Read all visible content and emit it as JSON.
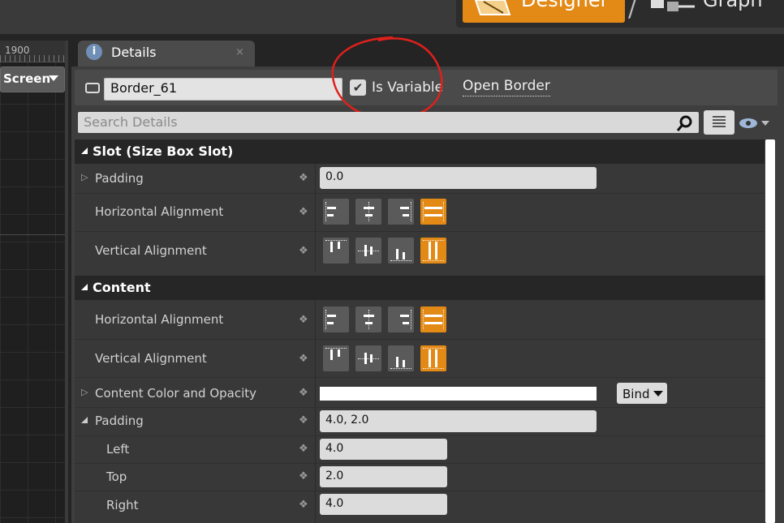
{
  "modes": {
    "designer": "Designer",
    "separator": "/",
    "graph": "Graph"
  },
  "viewport": {
    "ruler_value": "1900",
    "screen_label": "Screen"
  },
  "details": {
    "tab_label": "Details",
    "tab_icon": "i",
    "tab_close": "×",
    "widget_name": "Border_61",
    "is_variable_label": "Is Variable",
    "is_variable_checked": true,
    "checkmark": "✔",
    "open_border_label": "Open Border",
    "search_placeholder": "Search Details"
  },
  "slot": {
    "title": "Slot (Size Box Slot)",
    "padding_label": "Padding",
    "padding_value": "0.0",
    "h_align_label": "Horizontal Alignment",
    "v_align_label": "Vertical Alignment",
    "h_align_selected": "fill",
    "v_align_selected": "fill"
  },
  "content": {
    "title": "Content",
    "h_align_label": "Horizontal Alignment",
    "v_align_label": "Vertical Alignment",
    "h_align_selected": "fill",
    "v_align_selected": "fill",
    "color_label": "Content Color and Opacity",
    "color_value": "#ffffff",
    "bind_label": "Bind",
    "padding_label": "Padding",
    "padding_value": "4.0, 2.0",
    "left_label": "Left",
    "left_value": "4.0",
    "top_label": "Top",
    "top_value": "2.0",
    "right_label": "Right",
    "right_value": "4.0"
  },
  "colors": {
    "accent": "#e38a16",
    "panel": "#3e3e3e",
    "category": "#262626"
  },
  "glyphs": {
    "collapsed_arrow": "▷",
    "reset": "❖"
  }
}
